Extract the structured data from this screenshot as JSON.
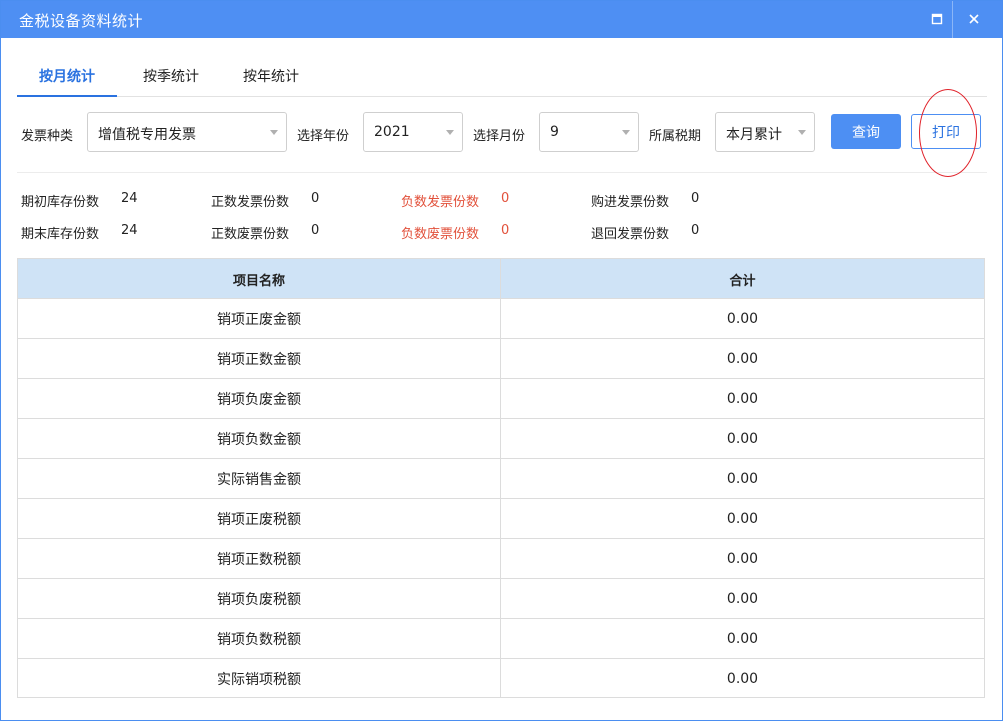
{
  "window": {
    "title": "金税设备资料统计"
  },
  "tabs": [
    {
      "label": "按月统计",
      "active": true
    },
    {
      "label": "按季统计",
      "active": false
    },
    {
      "label": "按年统计",
      "active": false
    }
  ],
  "filters": {
    "invoice_type": {
      "label": "发票种类",
      "value": "增值税专用发票"
    },
    "year": {
      "label": "选择年份",
      "value": "2021"
    },
    "month": {
      "label": "选择月份",
      "value": "9"
    },
    "tax_period": {
      "label": "所属税期",
      "value": "本月累计"
    },
    "query_label": "查询",
    "print_label": "打印"
  },
  "stats": [
    {
      "label": "期初库存份数",
      "value": "24",
      "highlight": false
    },
    {
      "label": "正数发票份数",
      "value": "0",
      "highlight": false
    },
    {
      "label": "负数发票份数",
      "value": "0",
      "highlight": true
    },
    {
      "label": "购进发票份数",
      "value": "0",
      "highlight": false
    },
    {
      "label": "期末库存份数",
      "value": "24",
      "highlight": false
    },
    {
      "label": "正数废票份数",
      "value": "0",
      "highlight": false
    },
    {
      "label": "负数废票份数",
      "value": "0",
      "highlight": true
    },
    {
      "label": "退回发票份数",
      "value": "0",
      "highlight": false
    }
  ],
  "table": {
    "columns": [
      "项目名称",
      "合计"
    ],
    "rows": [
      [
        "销项正废金额",
        "0.00"
      ],
      [
        "销项正数金额",
        "0.00"
      ],
      [
        "销项负废金额",
        "0.00"
      ],
      [
        "销项负数金额",
        "0.00"
      ],
      [
        "实际销售金额",
        "0.00"
      ],
      [
        "销项正废税额",
        "0.00"
      ],
      [
        "销项正数税额",
        "0.00"
      ],
      [
        "销项负废税额",
        "0.00"
      ],
      [
        "销项负数税额",
        "0.00"
      ],
      [
        "实际销项税额",
        "0.00"
      ]
    ]
  },
  "colors": {
    "titlebar": "#4e8ff3",
    "accent": "#2a72e0",
    "header_bg": "#cfe3f6",
    "highlight_text": "#e2513b",
    "annotation": "#e0222a"
  },
  "icons": {
    "maximize": "maximize-icon",
    "close": "close-icon",
    "dropdown": "chevron-down-icon"
  }
}
